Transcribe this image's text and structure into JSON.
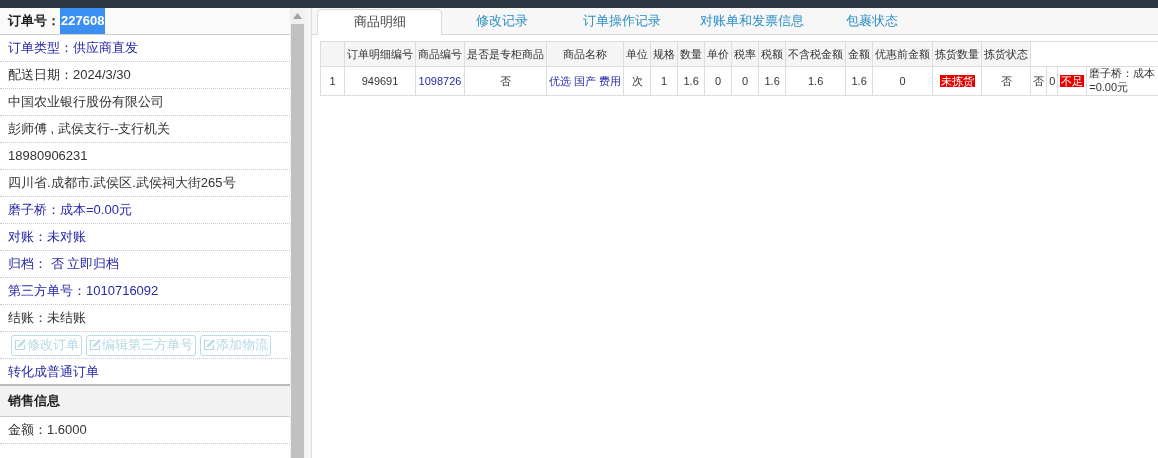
{
  "order_number": {
    "label": "订单号：",
    "value": "227608"
  },
  "info_rows": [
    {
      "text": "订单类型：供应商直发",
      "kind": "link"
    },
    {
      "text": "配送日期：2024/3/30",
      "kind": "plain"
    },
    {
      "text": "中国农业银行股份有限公司",
      "kind": "plain"
    },
    {
      "text": "彭师傅 , 武侯支行--支行机关",
      "kind": "plain"
    },
    {
      "text": "18980906231",
      "kind": "plain"
    },
    {
      "text": "四川省.成都市.武侯区.武侯祠大街265号",
      "kind": "plain"
    },
    {
      "text": "磨子桥：成本=0.00元",
      "kind": "link"
    },
    {
      "text": "对账：未对账",
      "kind": "link"
    },
    {
      "text": "归档： 否 立即归档",
      "kind": "link"
    },
    {
      "text": "第三方单号：1010716092",
      "kind": "link"
    },
    {
      "text": "结账：未结账",
      "kind": "plain"
    }
  ],
  "action_buttons": [
    {
      "label": "修改订单",
      "disabled": true
    },
    {
      "label": "编辑第三方单号",
      "disabled": true
    },
    {
      "label": "添加物流",
      "disabled": true
    }
  ],
  "convert_link": "转化成普通订单",
  "sales_section": {
    "title": "销售信息",
    "rows": [
      "金额：1.6000"
    ]
  },
  "tabs": [
    {
      "label": "商品明细",
      "selected": true
    },
    {
      "label": "修改记录",
      "selected": false
    },
    {
      "label": "订单操作记录",
      "selected": false
    },
    {
      "label": "对账单和发票信息",
      "selected": false
    },
    {
      "label": "包裹状态",
      "selected": false
    }
  ],
  "table": {
    "columns": [
      "订单明细编号",
      "商品编号",
      "是否是专柜商品",
      "商品名称",
      "单位",
      "规格",
      "数量",
      "单价",
      "税率",
      "税额",
      "不含税金额",
      "金额",
      "优惠前金额",
      "拣货数量",
      "拣货状态"
    ],
    "rows": [
      {
        "row_number": "1",
        "cells": [
          {
            "text": "949691",
            "kind": "plain"
          },
          {
            "text": "1098726",
            "kind": "link"
          },
          {
            "text": "否",
            "kind": "plain"
          },
          {
            "text": "优选 国产 费用",
            "kind": "link"
          },
          {
            "text": "次",
            "kind": "plain"
          },
          {
            "text": "1",
            "kind": "plain"
          },
          {
            "text": "1.6",
            "kind": "plain"
          },
          {
            "text": "0",
            "kind": "plain"
          },
          {
            "text": "0",
            "kind": "plain"
          },
          {
            "text": "1.6",
            "kind": "plain"
          },
          {
            "text": "1.6",
            "kind": "plain"
          },
          {
            "text": "1.6",
            "kind": "plain"
          },
          {
            "text": "0",
            "kind": "plain"
          },
          {
            "text": "未拣货",
            "kind": "alert"
          },
          {
            "text": "否",
            "kind": "plain"
          },
          {
            "text": "否",
            "kind": "plain"
          },
          {
            "text": "0",
            "kind": "plain"
          },
          {
            "text": "不足",
            "kind": "alert"
          },
          {
            "text": "磨子桥：成本=0.00元",
            "kind": "plain"
          }
        ]
      }
    ]
  }
}
